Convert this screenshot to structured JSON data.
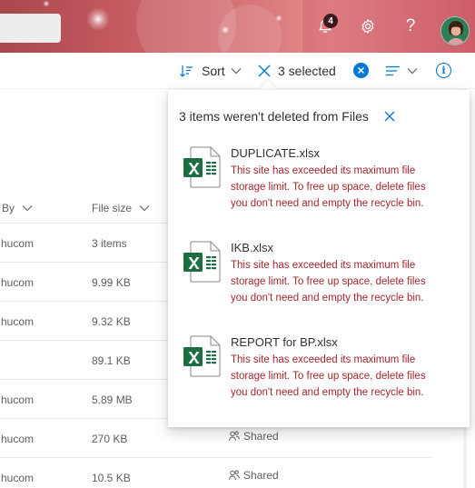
{
  "header": {
    "notifications_count": "4",
    "help_label": "?"
  },
  "command_bar": {
    "sort_label": "Sort",
    "selection_label": "3 selected"
  },
  "columns": {
    "modified_by": "By",
    "file_size": "File size"
  },
  "rows": [
    {
      "modified_by": "hucom",
      "file_size": "3 items",
      "sharing": ""
    },
    {
      "modified_by": "hucom",
      "file_size": "9.99 KB",
      "sharing": ""
    },
    {
      "modified_by": "hucom",
      "file_size": "9.32 KB",
      "sharing": ""
    },
    {
      "modified_by": "",
      "file_size": "89.1 KB",
      "sharing": ""
    },
    {
      "modified_by": "hucom",
      "file_size": "5.89 MB",
      "sharing": ""
    },
    {
      "modified_by": "hucom",
      "file_size": "270 KB",
      "sharing": "Shared"
    },
    {
      "modified_by": "hucom",
      "file_size": "10.5 KB",
      "sharing": "Shared"
    }
  ],
  "panel": {
    "title": "3 items weren't deleted from Files",
    "items": [
      {
        "name": "DUPLICATE.xlsx",
        "message": "This site has exceeded its maximum file storage limit. To free up space, delete files you don't need and empty the recycle bin."
      },
      {
        "name": "IKB.xlsx",
        "message": "This site has exceeded its maximum file storage limit. To free up space, delete files you don't need and empty the recycle bin."
      },
      {
        "name": "REPORT for BP.xlsx",
        "message": "This site has exceeded its maximum file storage limit. To free up space, delete files you don't need and empty the recycle bin."
      }
    ]
  },
  "colors": {
    "accent": "#0078d4",
    "error_text": "#a4262c",
    "excel_green": "#1d6f42"
  },
  "icons": [
    "bell-icon",
    "gear-icon",
    "help-icon",
    "sort-icon",
    "chevron-down-icon",
    "close-icon",
    "clear-selection-icon",
    "view-options-icon",
    "info-icon",
    "excel-file-icon",
    "shared-icon"
  ]
}
